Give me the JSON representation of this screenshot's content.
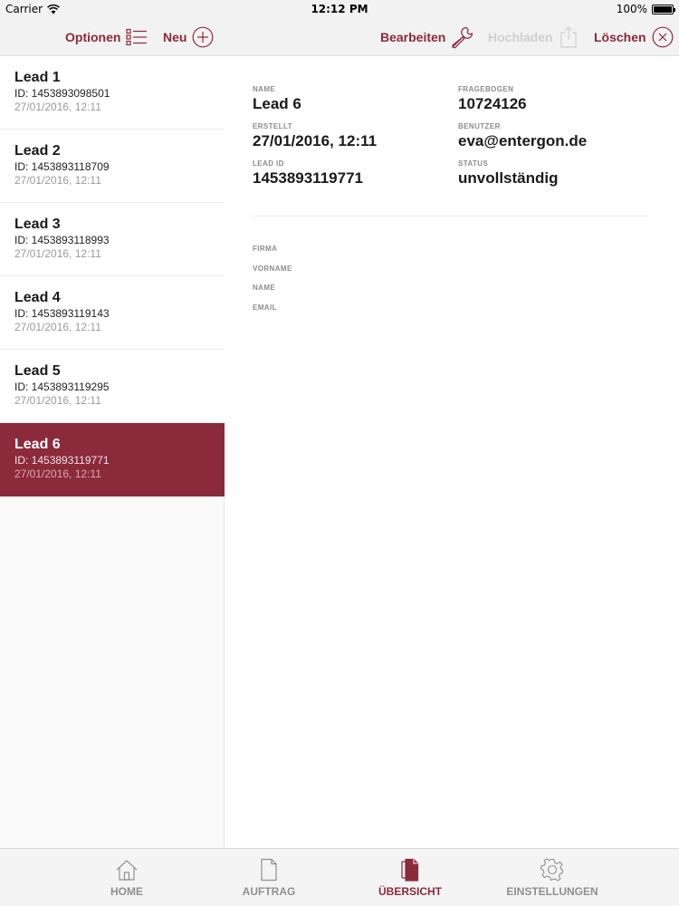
{
  "status_bar": {
    "carrier": "Carrier",
    "time": "12:12 PM",
    "battery": "100%"
  },
  "toolbar": {
    "options_label": "Optionen",
    "new_label": "Neu",
    "edit_label": "Bearbeiten",
    "upload_label": "Hochladen",
    "delete_label": "Löschen"
  },
  "leads": [
    {
      "title": "Lead 1",
      "id": "ID: 1453893098501",
      "date": "27/01/2016, 12:11"
    },
    {
      "title": "Lead 2",
      "id": "ID: 1453893118709",
      "date": "27/01/2016, 12:11"
    },
    {
      "title": "Lead 3",
      "id": "ID: 1453893118993",
      "date": "27/01/2016, 12:11"
    },
    {
      "title": "Lead 4",
      "id": "ID: 1453893119143",
      "date": "27/01/2016, 12:11"
    },
    {
      "title": "Lead 5",
      "id": "ID: 1453893119295",
      "date": "27/01/2016, 12:11"
    },
    {
      "title": "Lead 6",
      "id": "ID: 1453893119771",
      "date": "27/01/2016, 12:11"
    }
  ],
  "selected_lead_index": 5,
  "detail": {
    "name_label": "NAME",
    "name_value": "Lead 6",
    "questionnaire_label": "FRAGEBOGEN",
    "questionnaire_value": "10724126",
    "created_label": "ERSTELLT",
    "created_value": "27/01/2016, 12:11",
    "user_label": "BENUTZER",
    "user_value": "eva@entergon.de",
    "lead_id_label": "LEAD ID",
    "lead_id_value": "1453893119771",
    "status_label": "STATUS",
    "status_value": "unvollständig",
    "form_fields": [
      "FIRMA",
      "VORNAME",
      "NAME",
      "EMAIL"
    ]
  },
  "tabs": [
    {
      "label": "HOME",
      "icon": "home-icon"
    },
    {
      "label": "AUFTRAG",
      "icon": "document-icon"
    },
    {
      "label": "ÜBERSICHT",
      "icon": "documents-icon"
    },
    {
      "label": "EINSTELLUNGEN",
      "icon": "gear-icon"
    }
  ],
  "active_tab_index": 2,
  "colors": {
    "accent": "#8b2a3b",
    "disabled": "#cfcfcf",
    "tab_inactive": "#8f8f8f"
  }
}
